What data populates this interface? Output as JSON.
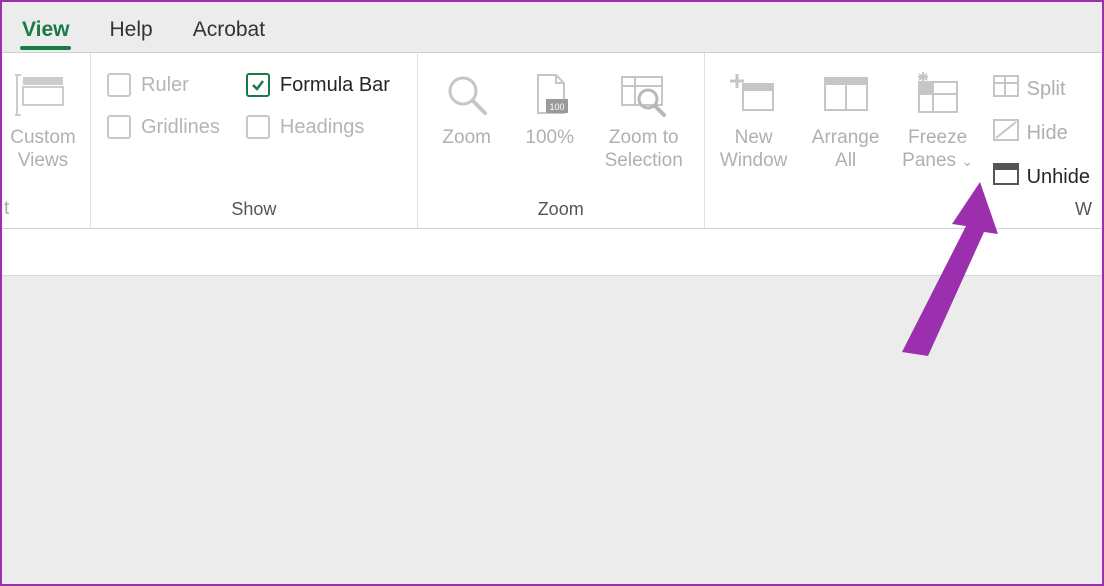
{
  "tabs": {
    "view": "View",
    "help": "Help",
    "acrobat": "Acrobat"
  },
  "views": {
    "custom_views": "Custom\nViews",
    "trunc": "t"
  },
  "show": {
    "label": "Show",
    "ruler": "Ruler",
    "gridlines": "Gridlines",
    "formula_bar": "Formula Bar",
    "headings": "Headings"
  },
  "zoom": {
    "label": "Zoom",
    "zoom": "Zoom",
    "hundred": "100%",
    "zoom_to_selection": "Zoom to\nSelection"
  },
  "window": {
    "label": "W",
    "new_window": "New\nWindow",
    "arrange_all": "Arrange\nAll",
    "freeze_panes": "Freeze\nPanes",
    "split": "Split",
    "hide": "Hide",
    "unhide": "Unhide"
  }
}
